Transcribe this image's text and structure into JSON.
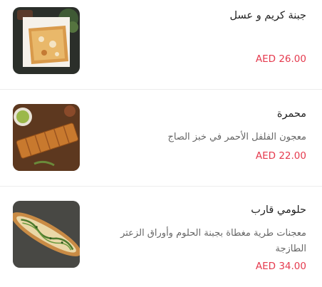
{
  "menu": {
    "items": [
      {
        "name": "جبنة كريم و عسل",
        "description": "",
        "price": "AED 26.00",
        "image_icon": "cheese-honey-flatbread-photo"
      },
      {
        "name": "محمرة",
        "description": "معجون الفلفل الأحمر في خبز الصاج",
        "price": "AED 22.00",
        "image_icon": "muhammara-saj-photo"
      },
      {
        "name": "حلومي قارب",
        "description": "معجنات طرية مغطاة بجبنة الحلوم وأوراق الزعتر الطازجة",
        "price": "AED 34.00",
        "image_icon": "halloumi-boat-pastry-photo"
      }
    ]
  },
  "colors": {
    "price": "#e53a4e",
    "divider": "#ececec"
  }
}
